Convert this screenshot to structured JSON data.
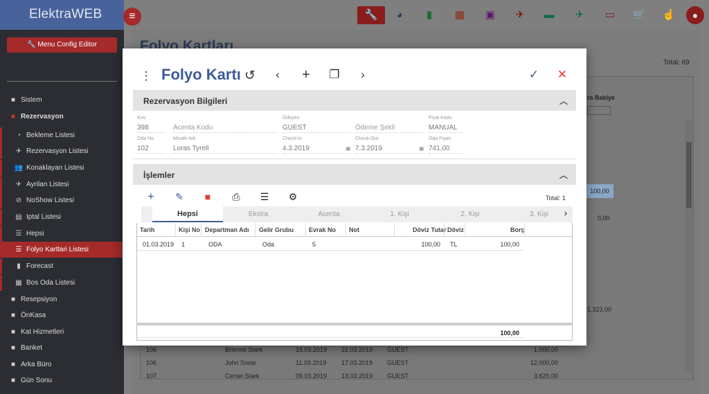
{
  "app": {
    "brand": "ElektraWEB",
    "config_button": "Menu Config Editor"
  },
  "sidebar": {
    "items": [
      {
        "label": "Sistem",
        "icon": "folder-icon"
      },
      {
        "label": "Rezervasyon",
        "icon": "folder-open-icon"
      },
      {
        "label": "Bekleme Listesi",
        "icon": "clock-icon"
      },
      {
        "label": "Rezervasyon Listesi",
        "icon": "plane-arrival-icon"
      },
      {
        "label": "Konaklayan Listesi",
        "icon": "people-icon"
      },
      {
        "label": "Ayrilan Listesi",
        "icon": "plane-departure-icon"
      },
      {
        "label": "NoShow Listesi",
        "icon": "eye-off-icon"
      },
      {
        "label": "Iptal Listesi",
        "icon": "document-icon"
      },
      {
        "label": "Hepsi",
        "icon": "list-icon"
      },
      {
        "label": "Folyo Kartlari Listesi",
        "icon": "list-icon"
      },
      {
        "label": "Forecast",
        "icon": "bar-chart-icon"
      },
      {
        "label": "Bos Oda Listesi",
        "icon": "grid-icon"
      },
      {
        "label": "Resepsiyon",
        "icon": "folder-icon"
      },
      {
        "label": "ÖnKasa",
        "icon": "folder-icon"
      },
      {
        "label": "Kat Hizmetleri",
        "icon": "folder-icon"
      },
      {
        "label": "Banket",
        "icon": "folder-icon"
      },
      {
        "label": "Arka Büro",
        "icon": "folder-icon"
      },
      {
        "label": "Gün Sonu",
        "icon": "folder-icon"
      }
    ]
  },
  "background": {
    "title": "Folyo Kartları",
    "total": "Total: 69",
    "col_bakiye": "ra Bakiye",
    "side_values": [
      "100,00",
      "0,00",
      "1.323,00"
    ],
    "rows": [
      {
        "no": "106",
        "name": "Brienne Stark",
        "in": "18.03.2019",
        "out": "22.03.2019",
        "type": "GUEST",
        "amount": "1.000,00"
      },
      {
        "no": "106",
        "name": "John Snow",
        "in": "11.03.2019",
        "out": "17.03.2019",
        "type": "GUEST",
        "amount": "12.000,00"
      },
      {
        "no": "107",
        "name": "Cersei Stark",
        "in": "09.03.2019",
        "out": "13.03.2019",
        "type": "GUEST",
        "amount": "3.620,00"
      }
    ]
  },
  "modal": {
    "title": "Folyo Kartı",
    "panel1": {
      "title": "Rezervasyon Bilgileri",
      "fields": {
        "kno_label": "Kno",
        "kno": "398",
        "acenta": "Acenta Kodu",
        "odeyen_label": "Ödeyen",
        "odeyen": "GUEST",
        "odeme": "Ödeme Şekli",
        "fiyat_kodu_label": "Fiyat Kodu",
        "fiyat_kodu": "MANUAL",
        "oda_no_label": "Oda No",
        "oda_no": "102",
        "misafir_label": "Misafir Adı",
        "misafir": "Loras Tyrell",
        "checkin_label": "Check-In",
        "checkin": "4.3.2019",
        "checkout_label": "Check-Out",
        "checkout": "7.3.2019",
        "oda_fiyati_label": "Oda Fiyatı",
        "oda_fiyati": "741,00"
      }
    },
    "panel2": {
      "title": "İşlemler",
      "total": "Total: 1",
      "tabs": [
        "Hepsi",
        "Ekstra",
        "Acenta",
        "1. Kişi",
        "2. Kişi",
        "3. Kişi"
      ],
      "columns": [
        "Tarih",
        "Kişi No",
        "Departman Adı",
        "Gelir Grubu",
        "Evrak No",
        "Not",
        "Döviz Tutar",
        "Döviz",
        "Borç"
      ],
      "rows": [
        {
          "tarih": "01.03.2019",
          "kisi": "1",
          "dept": "ODA",
          "gelir": "Oda",
          "evrak": "5",
          "not": "",
          "doviz_tutar": "100,00",
          "doviz": "TL",
          "borc": "100,00"
        }
      ],
      "sum": "100,00"
    }
  },
  "colors": {
    "accent": "#a52a2a",
    "title": "#3d5a96",
    "save": "#3d5a96",
    "close": "#e53935",
    "delete": "#e53935"
  }
}
